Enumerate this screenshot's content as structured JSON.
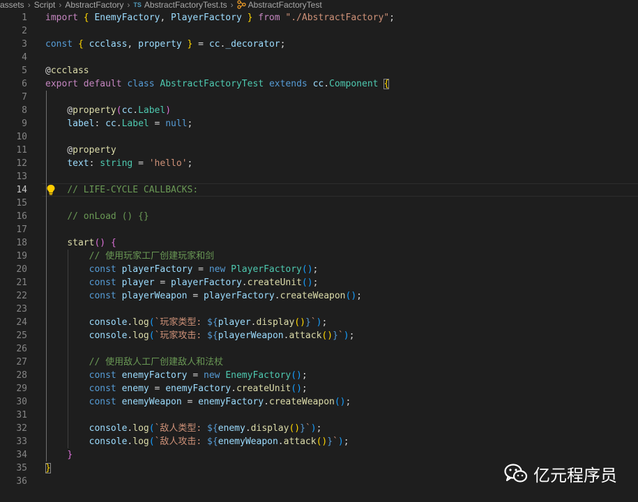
{
  "breadcrumb": {
    "items": [
      "assets",
      "Script",
      "AbstractFactory",
      "AbstractFactoryTest.ts",
      "AbstractFactoryTest"
    ],
    "file_icon_text": "TS"
  },
  "editor": {
    "current_line": 14,
    "line_numbers": [
      "1",
      "2",
      "3",
      "4",
      "5",
      "6",
      "7",
      "8",
      "9",
      "10",
      "11",
      "12",
      "13",
      "14",
      "15",
      "16",
      "17",
      "18",
      "19",
      "20",
      "21",
      "22",
      "23",
      "24",
      "25",
      "26",
      "27",
      "28",
      "29",
      "30",
      "31",
      "32",
      "33",
      "34",
      "35",
      "36"
    ],
    "lines": [
      [
        [
          "k",
          "import"
        ],
        [
          "p",
          " "
        ],
        [
          "y",
          "{"
        ],
        [
          "p",
          " "
        ],
        [
          "v",
          "EnemyFactory"
        ],
        [
          "p",
          ", "
        ],
        [
          "v",
          "PlayerFactory"
        ],
        [
          "p",
          " "
        ],
        [
          "y",
          "}"
        ],
        [
          "p",
          " "
        ],
        [
          "k",
          "from"
        ],
        [
          "p",
          " "
        ],
        [
          "s",
          "\"./AbstractFactory\""
        ],
        [
          "p",
          ";"
        ]
      ],
      [],
      [
        [
          "b",
          "const"
        ],
        [
          "p",
          " "
        ],
        [
          "y",
          "{"
        ],
        [
          "p",
          " "
        ],
        [
          "v",
          "ccclass"
        ],
        [
          "p",
          ", "
        ],
        [
          "v",
          "property"
        ],
        [
          "p",
          " "
        ],
        [
          "y",
          "}"
        ],
        [
          "p",
          " = "
        ],
        [
          "v",
          "cc"
        ],
        [
          "p",
          "."
        ],
        [
          "v",
          "_decorator"
        ],
        [
          "p",
          ";"
        ]
      ],
      [],
      [
        [
          "p",
          "@"
        ],
        [
          "f",
          "ccclass"
        ]
      ],
      [
        [
          "k",
          "export"
        ],
        [
          "p",
          " "
        ],
        [
          "k",
          "default"
        ],
        [
          "p",
          " "
        ],
        [
          "b",
          "class"
        ],
        [
          "p",
          " "
        ],
        [
          "t",
          "AbstractFactoryTest"
        ],
        [
          "p",
          " "
        ],
        [
          "b",
          "extends"
        ],
        [
          "p",
          " "
        ],
        [
          "v",
          "cc"
        ],
        [
          "p",
          "."
        ],
        [
          "t",
          "Component"
        ],
        [
          "p",
          " "
        ],
        [
          "yx",
          "{"
        ]
      ],
      [],
      [
        [
          "p",
          "    @"
        ],
        [
          "f",
          "property"
        ],
        [
          "m",
          "("
        ],
        [
          "v",
          "cc"
        ],
        [
          "p",
          "."
        ],
        [
          "t",
          "Label"
        ],
        [
          "m",
          ")"
        ]
      ],
      [
        [
          "p",
          "    "
        ],
        [
          "v",
          "label"
        ],
        [
          "p",
          ": "
        ],
        [
          "v",
          "cc"
        ],
        [
          "p",
          "."
        ],
        [
          "t",
          "Label"
        ],
        [
          "p",
          " = "
        ],
        [
          "b",
          "null"
        ],
        [
          "p",
          ";"
        ]
      ],
      [],
      [
        [
          "p",
          "    @"
        ],
        [
          "f",
          "property"
        ]
      ],
      [
        [
          "p",
          "    "
        ],
        [
          "v",
          "text"
        ],
        [
          "p",
          ": "
        ],
        [
          "t",
          "string"
        ],
        [
          "p",
          " = "
        ],
        [
          "s",
          "'hello'"
        ],
        [
          "p",
          ";"
        ]
      ],
      [],
      [
        [
          "p",
          "    "
        ],
        [
          "c",
          "// LIFE-CYCLE CALLBACKS:"
        ]
      ],
      [],
      [
        [
          "p",
          "    "
        ],
        [
          "c",
          "// onLoad () {}"
        ]
      ],
      [],
      [
        [
          "p",
          "    "
        ],
        [
          "f",
          "start"
        ],
        [
          "m",
          "()"
        ],
        [
          "p",
          " "
        ],
        [
          "m",
          "{"
        ]
      ],
      [
        [
          "p",
          "        "
        ],
        [
          "c",
          "// 使用玩家工厂创建玩家和剑"
        ]
      ],
      [
        [
          "p",
          "        "
        ],
        [
          "b",
          "const"
        ],
        [
          "p",
          " "
        ],
        [
          "v",
          "playerFactory"
        ],
        [
          "p",
          " = "
        ],
        [
          "b",
          "new"
        ],
        [
          "p",
          " "
        ],
        [
          "t",
          "PlayerFactory"
        ],
        [
          "bl",
          "()"
        ],
        [
          "p",
          ";"
        ]
      ],
      [
        [
          "p",
          "        "
        ],
        [
          "b",
          "const"
        ],
        [
          "p",
          " "
        ],
        [
          "v",
          "player"
        ],
        [
          "p",
          " = "
        ],
        [
          "v",
          "playerFactory"
        ],
        [
          "p",
          "."
        ],
        [
          "f",
          "createUnit"
        ],
        [
          "bl",
          "()"
        ],
        [
          "p",
          ";"
        ]
      ],
      [
        [
          "p",
          "        "
        ],
        [
          "b",
          "const"
        ],
        [
          "p",
          " "
        ],
        [
          "v",
          "playerWeapon"
        ],
        [
          "p",
          " = "
        ],
        [
          "v",
          "playerFactory"
        ],
        [
          "p",
          "."
        ],
        [
          "f",
          "createWeapon"
        ],
        [
          "bl",
          "()"
        ],
        [
          "p",
          ";"
        ]
      ],
      [],
      [
        [
          "p",
          "        "
        ],
        [
          "v",
          "console"
        ],
        [
          "p",
          "."
        ],
        [
          "f",
          "log"
        ],
        [
          "bl",
          "("
        ],
        [
          "s",
          "`玩家类型: "
        ],
        [
          "b",
          "${"
        ],
        [
          "v",
          "player"
        ],
        [
          "p",
          "."
        ],
        [
          "f",
          "display"
        ],
        [
          "y",
          "()"
        ],
        [
          "b",
          "}"
        ],
        [
          "s",
          "`"
        ],
        [
          "bl",
          ")"
        ],
        [
          "p",
          ";"
        ]
      ],
      [
        [
          "p",
          "        "
        ],
        [
          "v",
          "console"
        ],
        [
          "p",
          "."
        ],
        [
          "f",
          "log"
        ],
        [
          "bl",
          "("
        ],
        [
          "s",
          "`玩家攻击: "
        ],
        [
          "b",
          "${"
        ],
        [
          "v",
          "playerWeapon"
        ],
        [
          "p",
          "."
        ],
        [
          "f",
          "attack"
        ],
        [
          "y",
          "()"
        ],
        [
          "b",
          "}"
        ],
        [
          "s",
          "`"
        ],
        [
          "bl",
          ")"
        ],
        [
          "p",
          ";"
        ]
      ],
      [],
      [
        [
          "p",
          "        "
        ],
        [
          "c",
          "// 使用敌人工厂创建敌人和法杖"
        ]
      ],
      [
        [
          "p",
          "        "
        ],
        [
          "b",
          "const"
        ],
        [
          "p",
          " "
        ],
        [
          "v",
          "enemyFactory"
        ],
        [
          "p",
          " = "
        ],
        [
          "b",
          "new"
        ],
        [
          "p",
          " "
        ],
        [
          "t",
          "EnemyFactory"
        ],
        [
          "bl",
          "()"
        ],
        [
          "p",
          ";"
        ]
      ],
      [
        [
          "p",
          "        "
        ],
        [
          "b",
          "const"
        ],
        [
          "p",
          " "
        ],
        [
          "v",
          "enemy"
        ],
        [
          "p",
          " = "
        ],
        [
          "v",
          "enemyFactory"
        ],
        [
          "p",
          "."
        ],
        [
          "f",
          "createUnit"
        ],
        [
          "bl",
          "()"
        ],
        [
          "p",
          ";"
        ]
      ],
      [
        [
          "p",
          "        "
        ],
        [
          "b",
          "const"
        ],
        [
          "p",
          " "
        ],
        [
          "v",
          "enemyWeapon"
        ],
        [
          "p",
          " = "
        ],
        [
          "v",
          "enemyFactory"
        ],
        [
          "p",
          "."
        ],
        [
          "f",
          "createWeapon"
        ],
        [
          "bl",
          "()"
        ],
        [
          "p",
          ";"
        ]
      ],
      [],
      [
        [
          "p",
          "        "
        ],
        [
          "v",
          "console"
        ],
        [
          "p",
          "."
        ],
        [
          "f",
          "log"
        ],
        [
          "bl",
          "("
        ],
        [
          "s",
          "`敌人类型: "
        ],
        [
          "b",
          "${"
        ],
        [
          "v",
          "enemy"
        ],
        [
          "p",
          "."
        ],
        [
          "f",
          "display"
        ],
        [
          "y",
          "()"
        ],
        [
          "b",
          "}"
        ],
        [
          "s",
          "`"
        ],
        [
          "bl",
          ")"
        ],
        [
          "p",
          ";"
        ]
      ],
      [
        [
          "p",
          "        "
        ],
        [
          "v",
          "console"
        ],
        [
          "p",
          "."
        ],
        [
          "f",
          "log"
        ],
        [
          "bl",
          "("
        ],
        [
          "s",
          "`敌人攻击: "
        ],
        [
          "b",
          "${"
        ],
        [
          "v",
          "enemyWeapon"
        ],
        [
          "p",
          "."
        ],
        [
          "f",
          "attack"
        ],
        [
          "y",
          "()"
        ],
        [
          "b",
          "}"
        ],
        [
          "s",
          "`"
        ],
        [
          "bl",
          ")"
        ],
        [
          "p",
          ";"
        ]
      ],
      [
        [
          "p",
          "    "
        ],
        [
          "m",
          "}"
        ]
      ],
      [
        [
          "yx",
          "}"
        ]
      ],
      []
    ]
  },
  "watermark": {
    "text": "亿元程序员"
  },
  "colors": {
    "background": "#1e1e1e",
    "keyword": "#c586c0",
    "storage": "#569cd6",
    "variable": "#9cdcfe",
    "type": "#4ec9b0",
    "function": "#dcdcaa",
    "string": "#ce9178",
    "comment": "#6a9955",
    "lightbulb": "#ffcc00"
  },
  "icons": [
    "typescript-file-icon",
    "class-symbol-icon",
    "lightbulb-icon",
    "wechat-icon"
  ]
}
